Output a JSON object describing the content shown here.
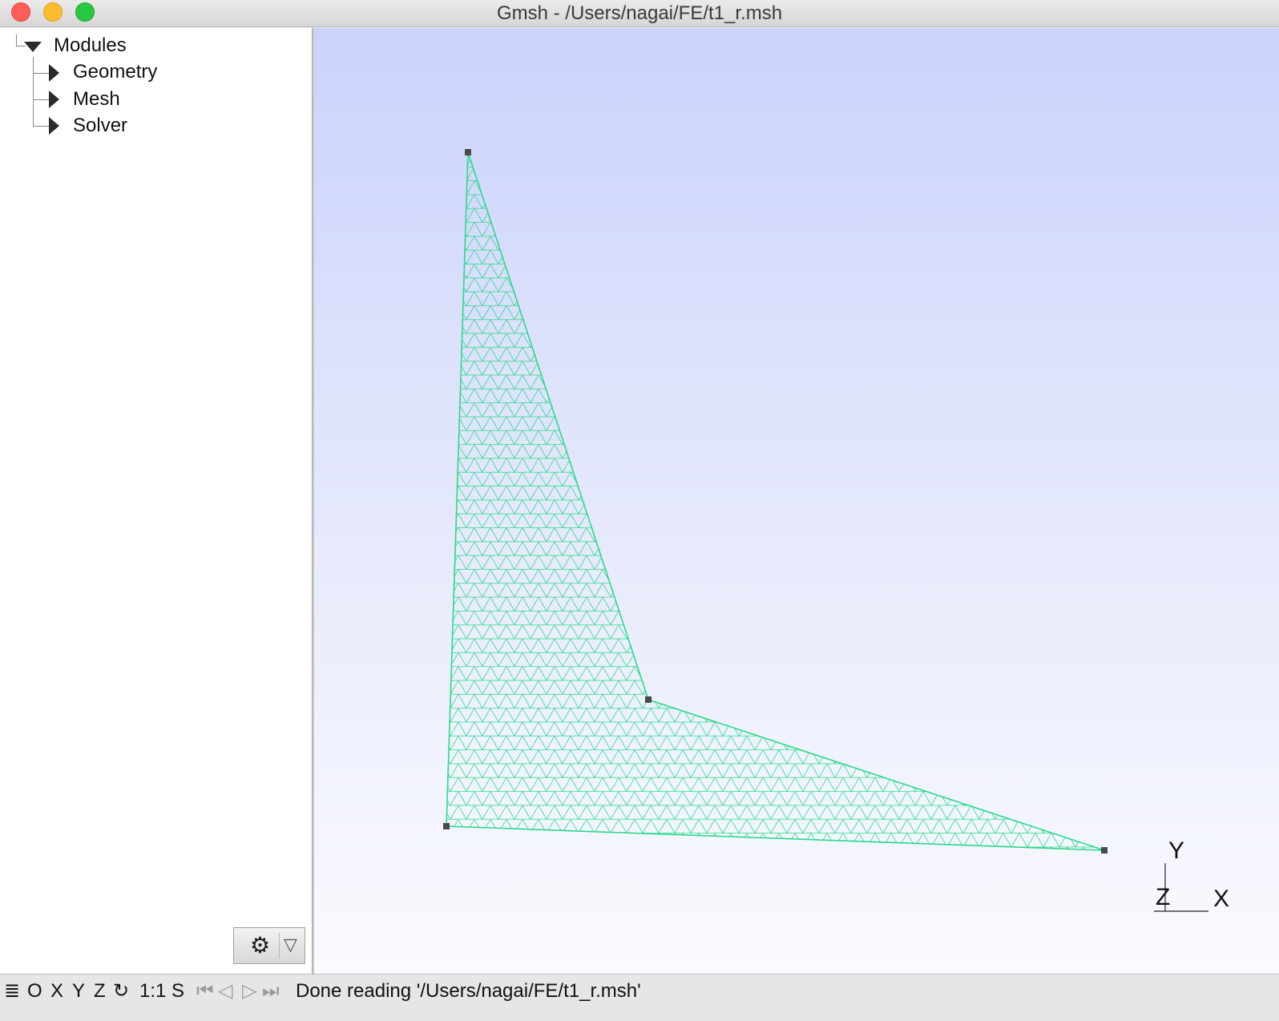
{
  "window": {
    "title": "Gmsh - /Users/nagai/FE/t1_r.msh"
  },
  "tree": {
    "root_label": "Modules",
    "items": [
      {
        "label": "Geometry"
      },
      {
        "label": "Mesh"
      },
      {
        "label": "Solver"
      }
    ]
  },
  "settings_button": {
    "icon": "gear-icon",
    "dropdown_icon": "dropdown-triangle-icon"
  },
  "viewport": {
    "mesh_color": "#2bd98a",
    "vertex_color": "#4a4a4a",
    "background_top": "#cbd2fc",
    "background_bottom": "#fafbff",
    "axes": {
      "y": "Y",
      "z": "Z",
      "x": "X"
    }
  },
  "statusbar": {
    "menu_icon": "≣",
    "buttons": [
      "O",
      "X",
      "Y",
      "Z"
    ],
    "rotate_icon": "↻",
    "scale_label": "1:1",
    "s_label": "S",
    "message": "Done reading '/Users/nagai/FE/t1_r.msh'"
  }
}
